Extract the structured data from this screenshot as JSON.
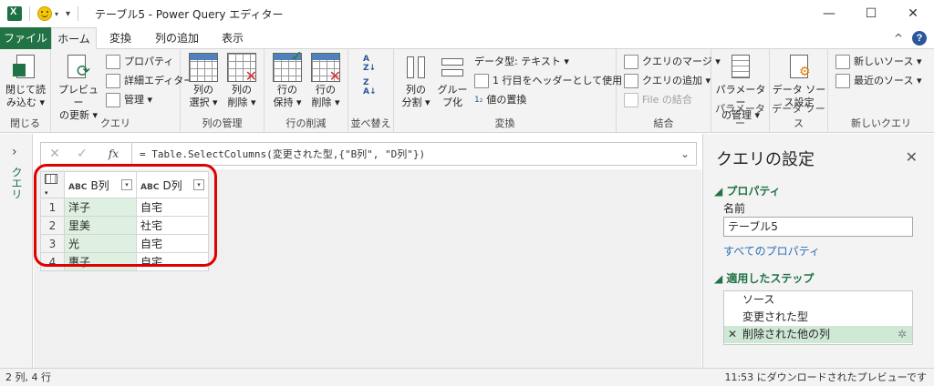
{
  "window": {
    "title": "テーブル5 - Power Query エディター",
    "minimize": "—",
    "maximize": "☐",
    "close": "✕"
  },
  "tabs": {
    "file": "ファイル",
    "home": "ホーム",
    "transform": "変換",
    "add_column": "列の追加",
    "view": "表示",
    "collapse": "^",
    "help": "?"
  },
  "ribbon": {
    "close": {
      "btn_line1": "閉じて読",
      "btn_line2": "み込む ▾",
      "label": "閉じる"
    },
    "query": {
      "preview_line1": "プレビュー",
      "preview_line2": "の更新 ▾",
      "properties": "プロパティ",
      "advanced_editor": "詳細エディター",
      "manage": "管理 ▾",
      "label": "クエリ"
    },
    "manage_columns": {
      "choose_line1": "列の",
      "choose_line2": "選択 ▾",
      "remove_line1": "列の",
      "remove_line2": "削除 ▾",
      "label": "列の管理"
    },
    "reduce_rows": {
      "keep_line1": "行の",
      "keep_line2": "保持 ▾",
      "remove_line1": "行の",
      "remove_line2": "削除 ▾",
      "label": "行の削減"
    },
    "sort": {
      "label": "並べ替え"
    },
    "transform": {
      "split_line1": "列の",
      "split_line2": "分割 ▾",
      "group_line1": "グルー",
      "group_line2": "プ化",
      "data_type": "データ型: テキスト ▾",
      "first_row_header": "1 行目をヘッダーとして使用 ▾",
      "replace_values": "値の置換",
      "label": "変換"
    },
    "combine": {
      "merge": "クエリのマージ ▾",
      "append": "クエリの追加 ▾",
      "combine_files": "File の結合",
      "label": "結合"
    },
    "parameters": {
      "btn_line1": "パラメーター",
      "btn_line2": "の管理 ▾",
      "label": "パラメーター"
    },
    "data_sources": {
      "btn_line1": "データ ソー",
      "btn_line2": "ス設定",
      "label": "データ ソース"
    },
    "new_query": {
      "new_source": "新しいソース ▾",
      "recent_sources": "最近のソース ▾",
      "label": "新しいクエリ"
    }
  },
  "left_pane": {
    "toggle": "›",
    "label": "クエリ"
  },
  "formula_bar": {
    "cancel": "✕",
    "commit": "✓",
    "fx": "fx",
    "formula": "= Table.SelectColumns(変更された型,{\"B列\", \"D列\"})",
    "expand": "⌄"
  },
  "table": {
    "type_badge": "ABC",
    "columns": [
      "B列",
      "D列"
    ],
    "rows": [
      [
        "1",
        "洋子",
        "自宅"
      ],
      [
        "2",
        "里美",
        "社宅"
      ],
      [
        "3",
        "光",
        "自宅"
      ],
      [
        "4",
        "惠子",
        "自宅"
      ]
    ]
  },
  "query_settings": {
    "title": "クエリの設定",
    "close": "✕",
    "properties_header": "◢ プロパティ",
    "name_label": "名前",
    "name_value": "テーブル5",
    "all_properties": "すべてのプロパティ",
    "steps_header": "◢ 適用したステップ",
    "steps": [
      "ソース",
      "変更された型",
      "削除された他の列"
    ],
    "step_delete": "✕",
    "step_gear": "✲"
  },
  "status": {
    "left": "2 列, 4 行",
    "right": "11:53 にダウンロードされたプレビューです"
  }
}
